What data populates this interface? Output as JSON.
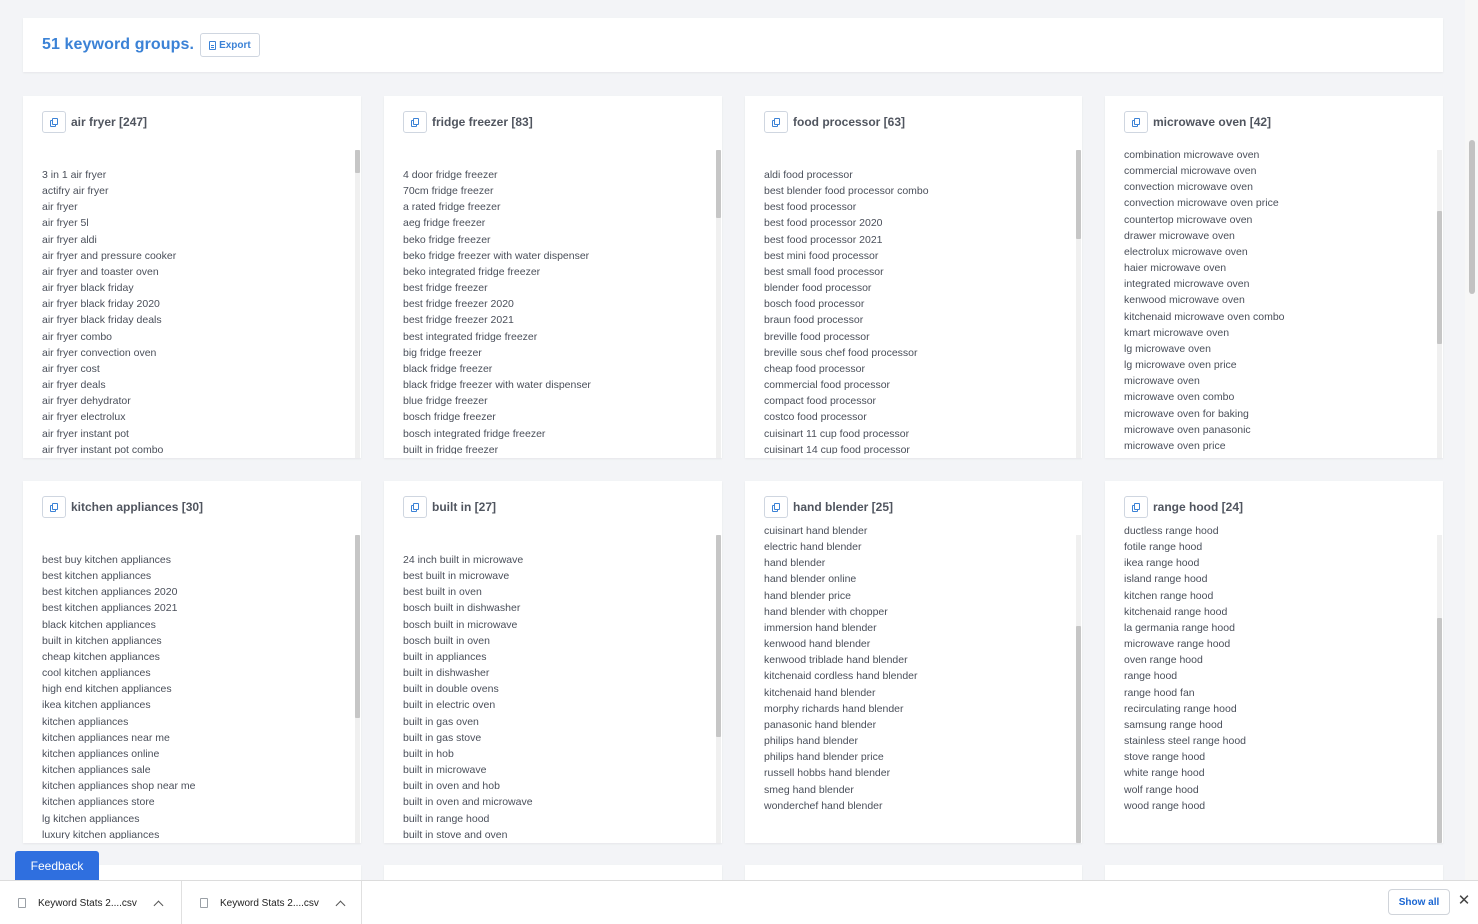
{
  "header": {
    "groups_title": "51 keyword groups.",
    "export_label": "Export"
  },
  "groups": [
    {
      "title": "air fryer [247]",
      "scroll_fraction": 0.0,
      "keywords": [
        "3 in 1 air fryer",
        "actifry air fryer",
        "air fryer",
        "air fryer 5l",
        "air fryer aldi",
        "air fryer and pressure cooker",
        "air fryer and toaster oven",
        "air fryer black friday",
        "air fryer black friday 2020",
        "air fryer black friday deals",
        "air fryer combo",
        "air fryer convection oven",
        "air fryer cost",
        "air fryer deals",
        "air fryer dehydrator",
        "air fryer electrolux",
        "air fryer instant pot",
        "air fryer instant pot combo"
      ]
    },
    {
      "title": "fridge freezer [83]",
      "scroll_fraction": 0.0,
      "keywords": [
        "4 door fridge freezer",
        "70cm fridge freezer",
        "a rated fridge freezer",
        "aeg fridge freezer",
        "beko fridge freezer",
        "beko fridge freezer with water dispenser",
        "beko integrated fridge freezer",
        "best fridge freezer",
        "best fridge freezer 2020",
        "best fridge freezer 2021",
        "best integrated fridge freezer",
        "big fridge freezer",
        "black fridge freezer",
        "black fridge freezer with water dispenser",
        "blue fridge freezer",
        "bosch fridge freezer",
        "bosch integrated fridge freezer",
        "built in fridge freezer"
      ]
    },
    {
      "title": "food processor [63]",
      "scroll_fraction": 0.0,
      "keywords": [
        "aldi food processor",
        "best blender food processor combo",
        "best food processor",
        "best food processor 2020",
        "best food processor 2021",
        "best mini food processor",
        "best small food processor",
        "blender food processor",
        "bosch food processor",
        "braun food processor",
        "breville food processor",
        "breville sous chef food processor",
        "cheap food processor",
        "commercial food processor",
        "compact food processor",
        "costco food processor",
        "cuisinart 11 cup food processor",
        "cuisinart 14 cup food processor"
      ]
    },
    {
      "title": "microwave oven [42]",
      "scroll_fraction": 0.35,
      "keywords": [
        "combination microwave oven",
        "commercial microwave oven",
        "convection microwave oven",
        "convection microwave oven price",
        "countertop microwave oven",
        "drawer microwave oven",
        "electrolux microwave oven",
        "haier microwave oven",
        "integrated microwave oven",
        "kenwood microwave oven",
        "kitchenaid microwave oven combo",
        "kmart microwave oven",
        "lg microwave oven",
        "lg microwave oven price",
        "microwave oven",
        "microwave oven combo",
        "microwave oven for baking",
        "microwave oven panasonic",
        "microwave oven price"
      ]
    },
    {
      "title": "kitchen appliances [30]",
      "scroll_fraction": 0.0,
      "keywords": [
        "best buy kitchen appliances",
        "best kitchen appliances",
        "best kitchen appliances 2020",
        "best kitchen appliances 2021",
        "black kitchen appliances",
        "built in kitchen appliances",
        "cheap kitchen appliances",
        "cool kitchen appliances",
        "high end kitchen appliances",
        "ikea kitchen appliances",
        "kitchen appliances",
        "kitchen appliances near me",
        "kitchen appliances online",
        "kitchen appliances sale",
        "kitchen appliances shop near me",
        "kitchen appliances store",
        "lg kitchen appliances",
        "luxury kitchen appliances"
      ]
    },
    {
      "title": "built in [27]",
      "scroll_fraction": 0.0,
      "keywords": [
        "24 inch built in microwave",
        "best built in microwave",
        "best built in oven",
        "bosch built in dishwasher",
        "bosch built in microwave",
        "bosch built in oven",
        "built in appliances",
        "built in dishwasher",
        "built in double ovens",
        "built in electric oven",
        "built in gas oven",
        "built in gas stove",
        "built in hob",
        "built in microwave",
        "built in oven and hob",
        "built in oven and microwave",
        "built in range hood",
        "built in stove and oven"
      ]
    },
    {
      "title": "hand blender [25]",
      "scroll_fraction": 1.0,
      "keywords": [
        "cuisinart hand blender",
        "electric hand blender",
        "hand blender",
        "hand blender online",
        "hand blender price",
        "hand blender with chopper",
        "immersion hand blender",
        "kenwood hand blender",
        "kenwood triblade hand blender",
        "kitchenaid cordless hand blender",
        "kitchenaid hand blender",
        "morphy richards hand blender",
        "panasonic hand blender",
        "philips hand blender",
        "philips hand blender price",
        "russell hobbs hand blender",
        "smeg hand blender",
        "wonderchef hand blender"
      ]
    },
    {
      "title": "range hood [24]",
      "scroll_fraction": 1.0,
      "keywords": [
        "ductless range hood",
        "fotile range hood",
        "ikea range hood",
        "island range hood",
        "kitchen range hood",
        "kitchenaid range hood",
        "la germania range hood",
        "microwave range hood",
        "oven range hood",
        "range hood",
        "range hood fan",
        "recirculating range hood",
        "samsung range hood",
        "stainless steel range hood",
        "stove range hood",
        "white range hood",
        "wolf range hood",
        "wood range hood"
      ]
    }
  ],
  "feedback_label": "Feedback",
  "downloads": [
    {
      "name": "Keyword Stats 2....csv"
    },
    {
      "name": "Keyword Stats 2....csv"
    }
  ],
  "download_bar": {
    "show_all_label": "Show all",
    "close_symbol": "✕"
  },
  "colors": {
    "accent": "#3b82d6",
    "feedback_bg": "#2f6fdf",
    "background": "#f3f4f7"
  }
}
